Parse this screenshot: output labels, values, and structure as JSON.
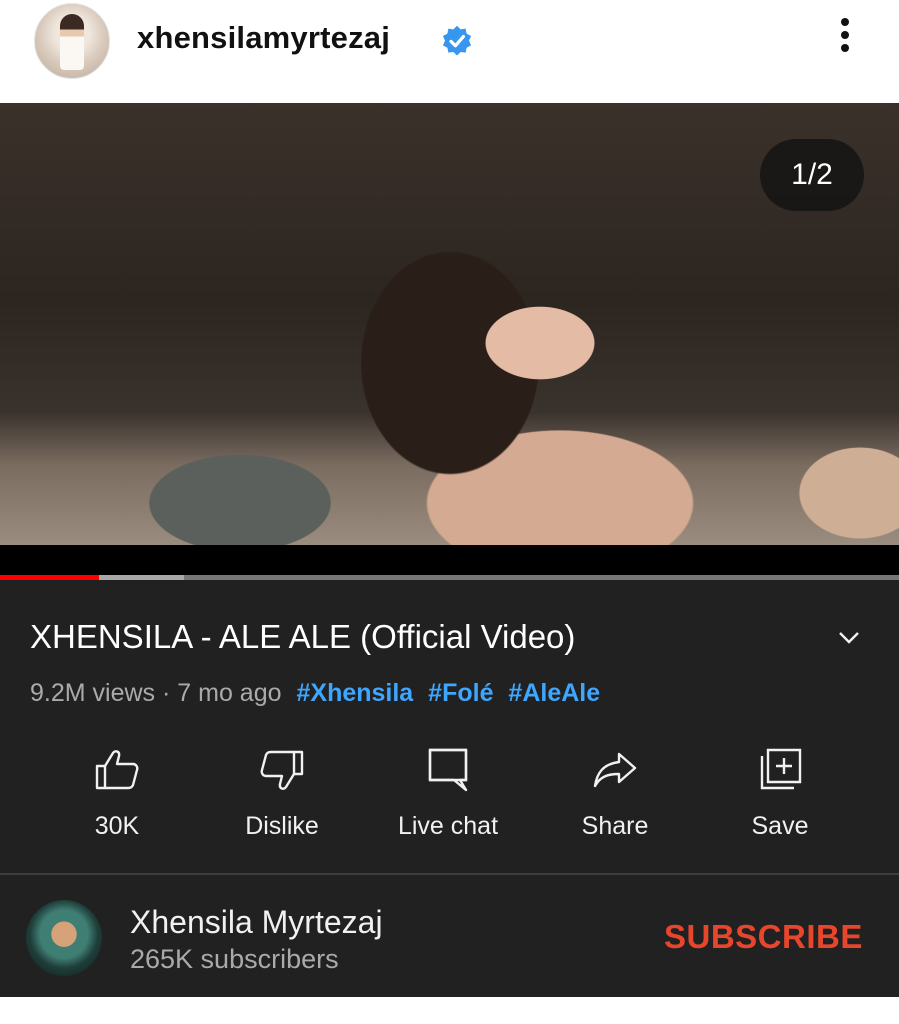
{
  "post": {
    "username": "xhensilamyrtezaj",
    "verified_icon": "verified-badge-icon",
    "more_icon": "more-options-icon"
  },
  "video": {
    "page_counter": "1/2",
    "progress_played_percent": 11,
    "progress_buffered_percent": 20.5
  },
  "details": {
    "title": "XHENSILA - ALE ALE (Official Video)",
    "views": "9.2M views",
    "separator": "·",
    "age": "7 mo ago",
    "hashtags": [
      "#Xhensila",
      "#Folé",
      "#AleAle"
    ]
  },
  "actions": {
    "like_label": "30K",
    "dislike_label": "Dislike",
    "live_chat_label": "Live chat",
    "share_label": "Share",
    "save_label": "Save"
  },
  "channel": {
    "name": "Xhensila Myrtezaj",
    "subscribers": "265K subscribers",
    "subscribe_label": "SUBSCRIBE"
  },
  "colors": {
    "card_background": "#212121",
    "hashtag": "#3ea6ff",
    "subscribe": "#e8452d",
    "progress_played": "#ff0000",
    "verified": "#3797f0"
  }
}
